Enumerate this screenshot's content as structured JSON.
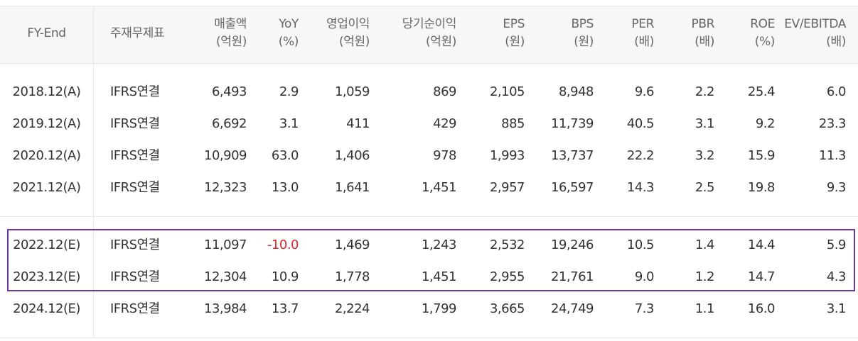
{
  "headers": [
    {
      "main": "FY-End",
      "unit": ""
    },
    {
      "main": "주재무제표",
      "unit": ""
    },
    {
      "main": "매출액",
      "unit": "(억원)"
    },
    {
      "main": "YoY",
      "unit": "(%)"
    },
    {
      "main": "영업이익",
      "unit": "(억원)"
    },
    {
      "main": "당기순이익",
      "unit": "(억원)"
    },
    {
      "main": "EPS",
      "unit": "(원)"
    },
    {
      "main": "BPS",
      "unit": "(원)"
    },
    {
      "main": "PER",
      "unit": "(배)"
    },
    {
      "main": "PBR",
      "unit": "(배)"
    },
    {
      "main": "ROE",
      "unit": "(%)"
    },
    {
      "main": "EV/EBITDA",
      "unit": "(배)"
    }
  ],
  "rows": [
    [
      "2018.12(A)",
      "IFRS연결",
      "6,493",
      "2.9",
      "1,059",
      "869",
      "2,105",
      "8,948",
      "9.6",
      "2.2",
      "25.4",
      "6.0"
    ],
    [
      "2019.12(A)",
      "IFRS연결",
      "6,692",
      "3.1",
      "411",
      "429",
      "885",
      "11,739",
      "40.5",
      "3.1",
      "9.2",
      "23.3"
    ],
    [
      "2020.12(A)",
      "IFRS연결",
      "10,909",
      "63.0",
      "1,406",
      "978",
      "1,993",
      "13,737",
      "22.2",
      "3.2",
      "15.9",
      "11.3"
    ],
    [
      "2021.12(A)",
      "IFRS연결",
      "12,323",
      "13.0",
      "1,641",
      "1,451",
      "2,957",
      "16,597",
      "14.3",
      "2.5",
      "19.8",
      "9.3"
    ],
    [
      "2022.12(E)",
      "IFRS연결",
      "11,097",
      "-10.0",
      "1,469",
      "1,243",
      "2,532",
      "19,246",
      "10.5",
      "1.4",
      "14.4",
      "5.9"
    ],
    [
      "2023.12(E)",
      "IFRS연결",
      "12,304",
      "10.9",
      "1,778",
      "1,451",
      "2,955",
      "21,761",
      "9.0",
      "1.2",
      "14.7",
      "4.3"
    ],
    [
      "2024.12(E)",
      "IFRS연결",
      "13,984",
      "13.7",
      "2,224",
      "1,799",
      "3,665",
      "24,749",
      "7.3",
      "1.1",
      "16.0",
      "3.1"
    ]
  ],
  "colors": {
    "negative": "#e0232d",
    "highlight_border": "#6a39a0",
    "header_bg": "#f7f7f7",
    "grid": "#e6e6e6"
  }
}
